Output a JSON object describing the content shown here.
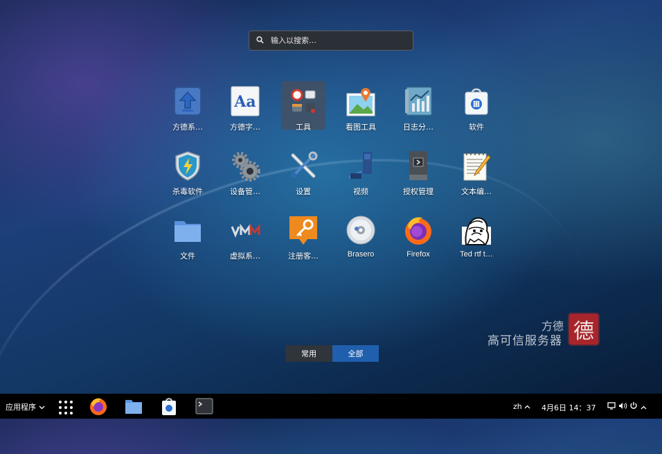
{
  "search": {
    "placeholder": "输入以搜索…"
  },
  "apps": [
    {
      "label": "方德系…"
    },
    {
      "label": "方德字…"
    },
    {
      "label": "工具"
    },
    {
      "label": "看图工具"
    },
    {
      "label": "日志分…"
    },
    {
      "label": "软件"
    },
    {
      "label": "杀毒软件"
    },
    {
      "label": "设备管…"
    },
    {
      "label": "设置"
    },
    {
      "label": "视频"
    },
    {
      "label": "授权管理"
    },
    {
      "label": "文本编…"
    },
    {
      "label": "文件"
    },
    {
      "label": "虚拟系…"
    },
    {
      "label": "注册客…"
    },
    {
      "label": "Brasero"
    },
    {
      "label": "Firefox"
    },
    {
      "label": "Ted rtf t…"
    }
  ],
  "font_app_glyph": "Aa",
  "tabs": {
    "frequent": "常用",
    "all": "全部"
  },
  "watermark": {
    "line1": "方德",
    "line2": "高可信服务器",
    "seal": "德"
  },
  "taskbar": {
    "apps_menu": "应用程序",
    "lang": "zh",
    "datetime": "4月6日 14：37"
  },
  "colors": {
    "accent": "#1f5fae",
    "taskbar": "#000000"
  }
}
